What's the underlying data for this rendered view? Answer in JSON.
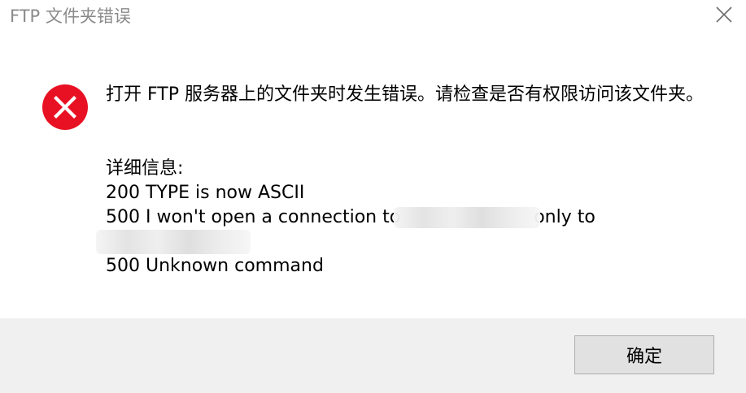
{
  "window": {
    "title": "FTP 文件夹错误"
  },
  "message": {
    "text": "打开 FTP 服务器上的文件夹时发生错误。请检查是否有权限访问该文件夹。"
  },
  "details": {
    "header": "详细信息:",
    "line1": "200 TYPE is now ASCII",
    "line2_prefix": "500 I won't open a connection to",
    "line2_suffix": "only to",
    "line4": "500 Unknown command"
  },
  "buttons": {
    "ok_label": "确定"
  },
  "icons": {
    "error": "error-circle-x-icon",
    "close": "close-icon"
  },
  "colors": {
    "error_red": "#e81123",
    "title_gray": "#8a8a8a",
    "footer_bg": "#f0f0f0",
    "button_bg": "#e1e1e1",
    "button_border": "#adadad"
  }
}
